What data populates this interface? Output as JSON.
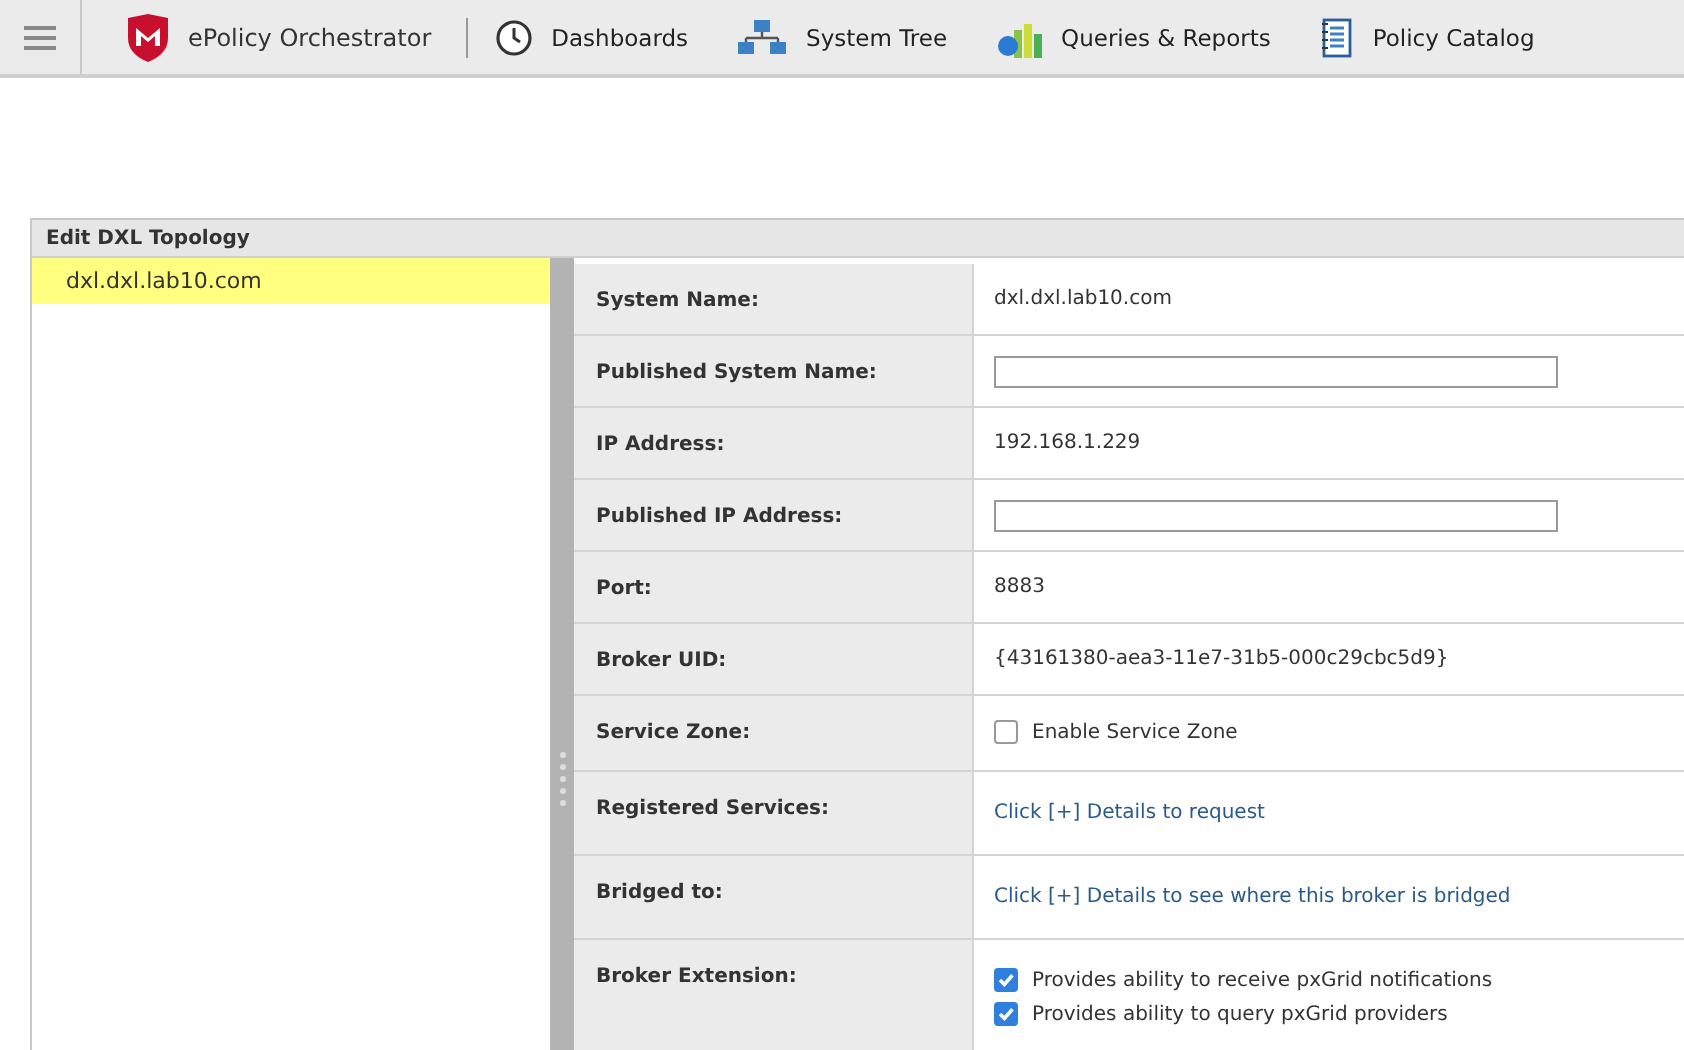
{
  "nav": {
    "product": "ePolicy Orchestrator",
    "items": [
      {
        "label": "Dashboards"
      },
      {
        "label": "System Tree"
      },
      {
        "label": "Queries & Reports"
      },
      {
        "label": "Policy Catalog"
      }
    ]
  },
  "panel": {
    "title": "Edit DXL Topology",
    "tree": [
      {
        "label": "dxl.dxl.lab10.com",
        "selected": true
      }
    ],
    "rows": [
      {
        "label": "System Name:",
        "kind": "text",
        "value": "dxl.dxl.lab10.com"
      },
      {
        "label": "Published System Name:",
        "kind": "input"
      },
      {
        "label": "IP Address:",
        "kind": "text",
        "value": "192.168.1.229"
      },
      {
        "label": "Published IP Address:",
        "kind": "input"
      },
      {
        "label": "Port:",
        "kind": "text",
        "value": "8883"
      },
      {
        "label": "Broker UID:",
        "kind": "text",
        "value": "{43161380-aea3-11e7-31b5-000c29cbc5d9}"
      },
      {
        "label": "Service Zone:",
        "kind": "checks",
        "options": [
          {
            "label": "Enable Service Zone",
            "checked": false
          }
        ]
      },
      {
        "label": "Registered Services:",
        "kind": "link",
        "value": "Click [+] Details to request"
      },
      {
        "label": "Bridged to:",
        "kind": "link",
        "value": "Click [+] Details to see where this broker is bridged"
      },
      {
        "label": "Broker Extension:",
        "kind": "checks",
        "options": [
          {
            "label": "Provides ability to receive pxGrid notifications",
            "checked": true
          },
          {
            "label": "Provides ability to query pxGrid providers",
            "checked": true
          }
        ]
      }
    ]
  }
}
